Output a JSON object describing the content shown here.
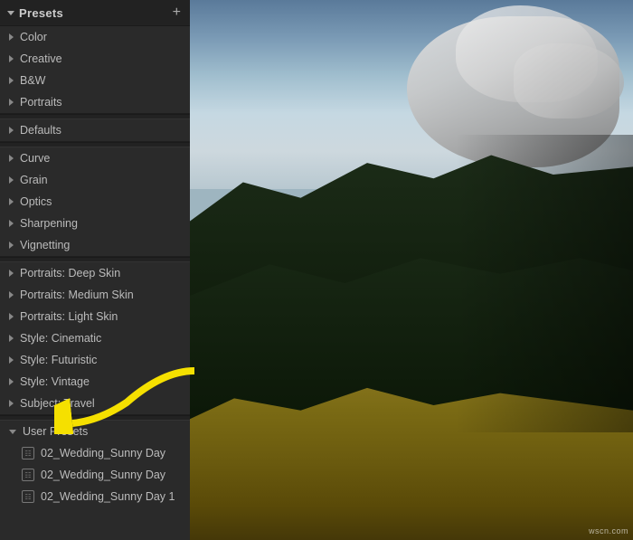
{
  "sidebar": {
    "title": "Presets",
    "add_button": "+",
    "groups": [
      {
        "id": "group1",
        "items": [
          {
            "label": "Color",
            "type": "collapsed"
          },
          {
            "label": "Creative",
            "type": "collapsed"
          },
          {
            "label": "B&W",
            "type": "collapsed"
          },
          {
            "label": "Portraits",
            "type": "collapsed"
          }
        ]
      },
      {
        "id": "group2",
        "items": [
          {
            "label": "Defaults",
            "type": "collapsed"
          }
        ]
      },
      {
        "id": "group3",
        "items": [
          {
            "label": "Curve",
            "type": "collapsed"
          },
          {
            "label": "Grain",
            "type": "collapsed"
          },
          {
            "label": "Optics",
            "type": "collapsed"
          },
          {
            "label": "Sharpening",
            "type": "collapsed"
          },
          {
            "label": "Vignetting",
            "type": "collapsed"
          }
        ]
      },
      {
        "id": "group4",
        "items": [
          {
            "label": "Portraits: Deep Skin",
            "type": "collapsed"
          },
          {
            "label": "Portraits: Medium Skin",
            "type": "collapsed"
          },
          {
            "label": "Portraits: Light Skin",
            "type": "collapsed"
          },
          {
            "label": "Style: Cinematic",
            "type": "collapsed"
          },
          {
            "label": "Style: Futuristic",
            "type": "collapsed"
          },
          {
            "label": "Style: Vintage",
            "type": "collapsed"
          },
          {
            "label": "Subject: Travel",
            "type": "collapsed"
          }
        ]
      },
      {
        "id": "group5",
        "items": [
          {
            "label": "User Presets",
            "type": "expanded"
          },
          {
            "label": "02_Wedding_Sunny Day",
            "type": "file"
          },
          {
            "label": "02_Wedding_Sunny Day",
            "type": "file"
          },
          {
            "label": "02_Wedding_Sunny Day 1",
            "type": "file"
          }
        ]
      }
    ]
  },
  "watermark": "wscn.com"
}
